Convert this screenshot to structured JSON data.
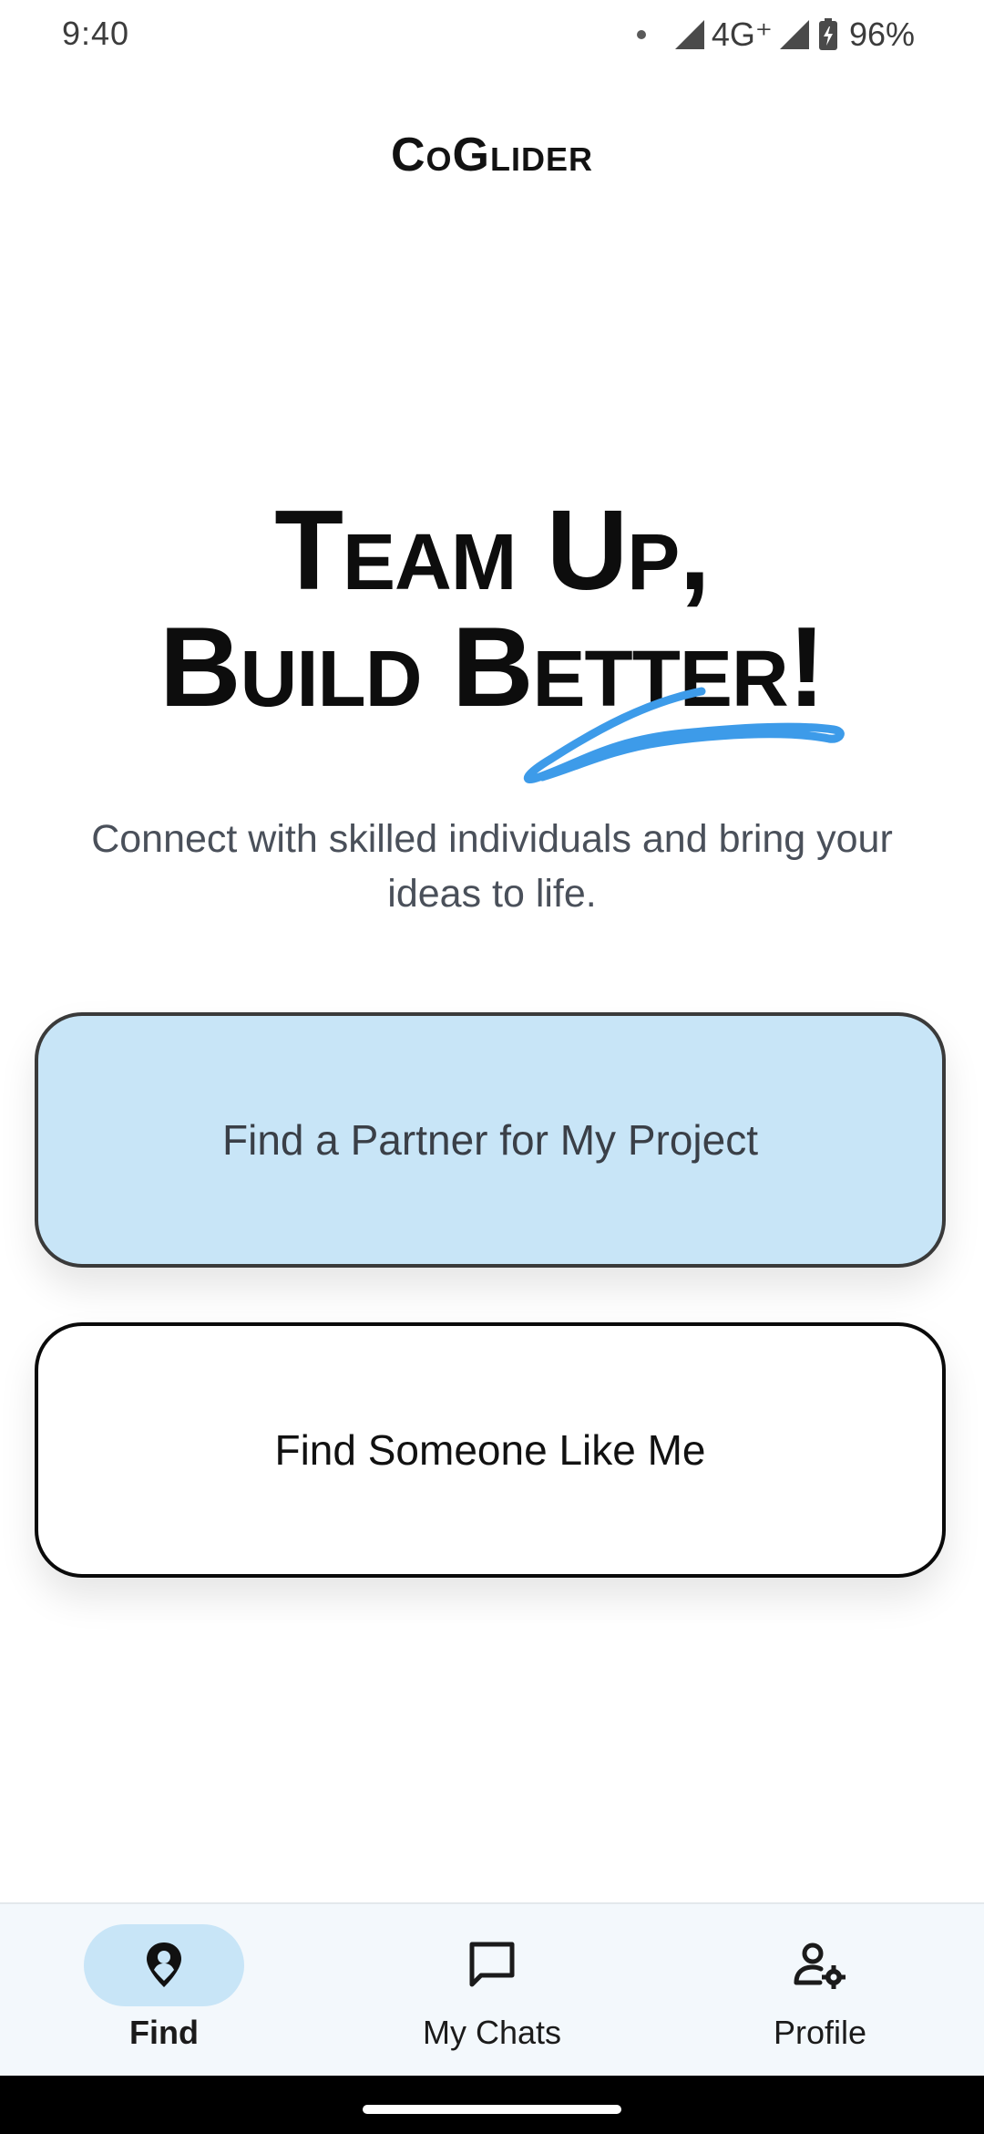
{
  "status_bar": {
    "time": "9:40",
    "network": "4G⁺",
    "battery": "96%"
  },
  "app": {
    "title": "CoGlider"
  },
  "hero": {
    "line1": "Team Up,",
    "line2": "Build Better!",
    "subtitle": "Connect with skilled individuals and bring your ideas to life.",
    "accent_color": "#3d9be9"
  },
  "actions": {
    "primary_label": "Find a Partner for My Project",
    "secondary_label": "Find Someone Like Me"
  },
  "nav": {
    "items": [
      {
        "label": "Find",
        "icon": "location-pin-icon",
        "active": true
      },
      {
        "label": "My Chats",
        "icon": "chat-bubble-icon",
        "active": false
      },
      {
        "label": "Profile",
        "icon": "user-settings-icon",
        "active": false
      }
    ]
  },
  "colors": {
    "primary_card_bg": "#c8e5f7",
    "nav_bg": "#f3f8fc",
    "active_pill": "#c8e5f7"
  }
}
